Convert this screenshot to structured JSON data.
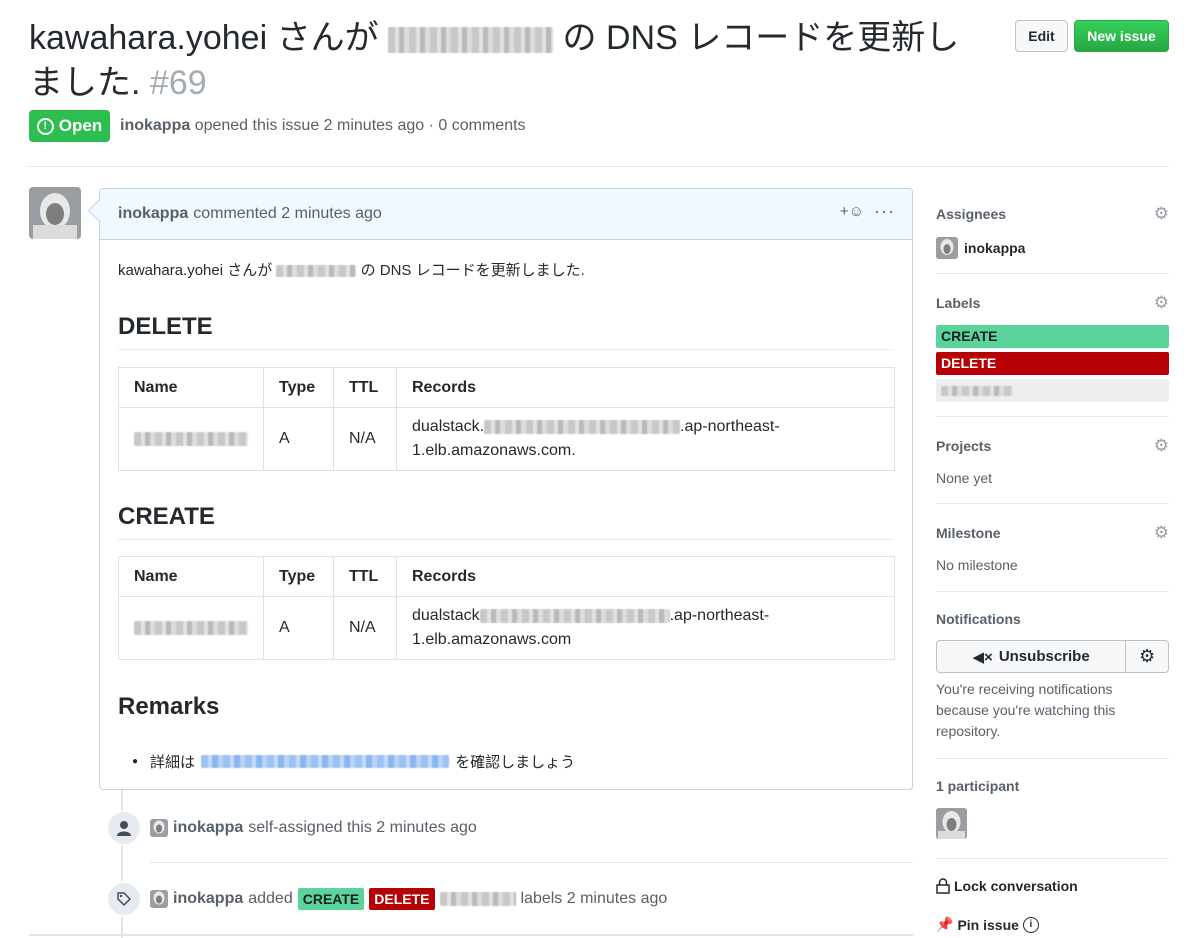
{
  "issue": {
    "title_prefix": "kawahara.yohei さんが",
    "title_suffix": "の DNS レコードを更新しました.",
    "number": "#69",
    "state": "Open",
    "author": "inokappa",
    "opened_text": "opened this issue 2 minutes ago · 0 comments"
  },
  "header": {
    "edit_label": "Edit",
    "new_issue_label": "New issue"
  },
  "comment": {
    "author": "inokappa",
    "time_text": "commented 2 minutes ago",
    "intro_prefix": "kawahara.yohei さんが",
    "intro_suffix": "の DNS レコードを更新しました.",
    "react_icon": "+☺",
    "more_icon": "···",
    "sections": [
      {
        "heading": "DELETE",
        "headers": [
          "Name",
          "Type",
          "TTL",
          "Records"
        ],
        "row": {
          "type": "A",
          "ttl": "N/A",
          "records_prefix": "dualstack.",
          "records_suffix": ".ap-northeast-",
          "records_line2": "1.elb.amazonaws.com."
        }
      },
      {
        "heading": "CREATE",
        "headers": [
          "Name",
          "Type",
          "TTL",
          "Records"
        ],
        "row": {
          "type": "A",
          "ttl": "N/A",
          "records_prefix": "dualstack",
          "records_suffix": ".ap-northeast-",
          "records_line2": "1.elb.amazonaws.com"
        }
      }
    ],
    "remarks_heading": "Remarks",
    "remarks_prefix": "詳細は",
    "remarks_suffix": "を確認しましょう"
  },
  "timeline": [
    {
      "author": "inokappa",
      "text": "self-assigned this 2 minutes ago",
      "icon": "person-icon"
    },
    {
      "author": "inokappa",
      "added": "added",
      "labels": [
        "CREATE",
        "DELETE"
      ],
      "suffix": "labels 2 minutes ago",
      "icon": "tag-icon"
    }
  ],
  "sidebar": {
    "assignees": {
      "title": "Assignees",
      "user": "inokappa"
    },
    "labels": {
      "title": "Labels",
      "items": [
        "CREATE",
        "DELETE"
      ]
    },
    "projects": {
      "title": "Projects",
      "value": "None yet"
    },
    "milestone": {
      "title": "Milestone",
      "value": "No milestone"
    },
    "notifications": {
      "title": "Notifications",
      "button": "Unsubscribe",
      "desc": "You're receiving notifications because you're watching this repository."
    },
    "participants": {
      "title": "1 participant"
    },
    "lock": "Lock conversation",
    "pin": "Pin issue"
  },
  "colors": {
    "create": "#5ad49b",
    "delete": "#b60205",
    "open": "#2cbe4e",
    "primary": "#2ea44f"
  }
}
